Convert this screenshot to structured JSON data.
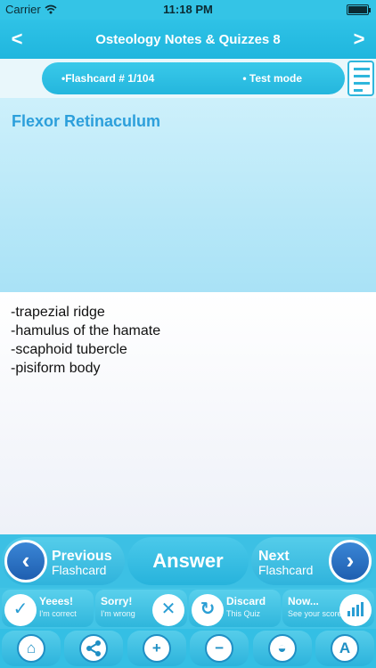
{
  "status_bar": {
    "carrier": "Carrier",
    "time": "11:18 PM"
  },
  "title_bar": {
    "title": "Osteology Notes & Quizzes 8",
    "back_glyph": "<",
    "forward_glyph": ">"
  },
  "info_bar": {
    "flashcard": "•Flashcard #  1/104",
    "mode": "• Test mode"
  },
  "question": "Flexor Retinaculum",
  "answer_lines": [
    "-trapezial ridge",
    "-hamulus of the hamate",
    "-scaphoid tubercle",
    "-pisiform body"
  ],
  "nav": {
    "previous_big": "Previous",
    "previous_small": "Flashcard",
    "answer": "Answer",
    "next_big": "Next",
    "next_small": "Flashcard"
  },
  "feedback": [
    {
      "title": "Yeees!",
      "sub": "I'm correct",
      "icon": "check-icon"
    },
    {
      "title": "Sorry!",
      "sub": "I'm wrong",
      "icon": "cross-icon"
    },
    {
      "title": "Discard",
      "sub": "This Quiz",
      "icon": "recycle-icon"
    },
    {
      "title": "Now...",
      "sub": "See your score",
      "icon": "chart-icon"
    }
  ],
  "tools": [
    "home-icon",
    "share-icon",
    "zoom-in-icon",
    "zoom-out-icon",
    "bucket-icon",
    "font-icon"
  ],
  "colors": {
    "accent": "#34c4e6",
    "question_text": "#2c9fdb",
    "arrow_blue": "#1f5fb0"
  }
}
